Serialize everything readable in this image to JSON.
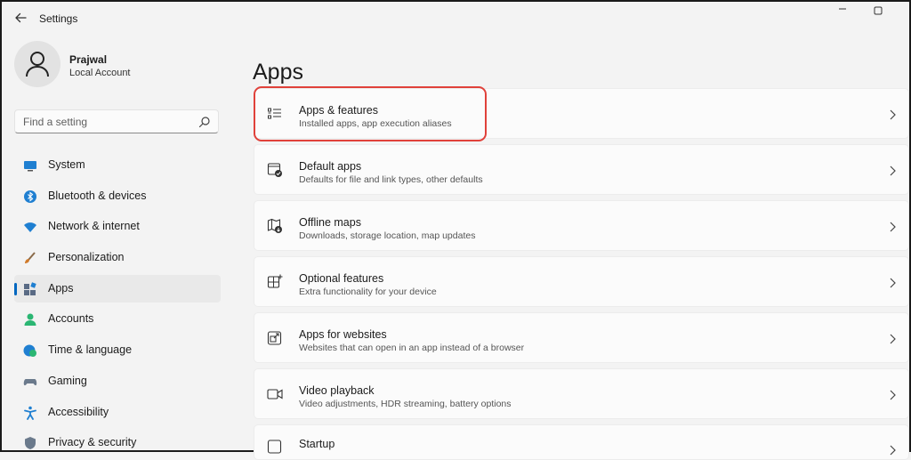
{
  "window": {
    "app_title": "Settings",
    "controls": [
      "minimize-icon",
      "maximize-icon"
    ]
  },
  "profile": {
    "name": "Prajwal",
    "account_type": "Local Account"
  },
  "search": {
    "placeholder": "Find a setting"
  },
  "sidebar": {
    "items": [
      {
        "label": "System",
        "icon": "monitor-icon",
        "color": "#1f7fd1"
      },
      {
        "label": "Bluetooth & devices",
        "icon": "bluetooth-icon",
        "color": "#1f7fd1"
      },
      {
        "label": "Network & internet",
        "icon": "wifi-icon",
        "color": "#1f7fd1"
      },
      {
        "label": "Personalization",
        "icon": "brush-icon",
        "color": "#d07a2a"
      },
      {
        "label": "Apps",
        "icon": "apps-icon",
        "color": "#5a6b85",
        "selected": true
      },
      {
        "label": "Accounts",
        "icon": "person-icon",
        "color": "#2bb673"
      },
      {
        "label": "Time & language",
        "icon": "globe-clock-icon",
        "color": "#1f7fd1"
      },
      {
        "label": "Gaming",
        "icon": "gamepad-icon",
        "color": "#6b7a8c"
      },
      {
        "label": "Accessibility",
        "icon": "accessibility-icon",
        "color": "#1f7fd1"
      },
      {
        "label": "Privacy & security",
        "icon": "shield-icon",
        "color": "#6b7a8c"
      }
    ]
  },
  "main": {
    "title": "Apps",
    "cards": [
      {
        "title": "Apps & features",
        "subtitle": "Installed apps, app execution aliases",
        "icon": "list-icon",
        "highlighted": true
      },
      {
        "title": "Default apps",
        "subtitle": "Defaults for file and link types, other defaults",
        "icon": "default-apps-icon"
      },
      {
        "title": "Offline maps",
        "subtitle": "Downloads, storage location, map updates",
        "icon": "map-download-icon"
      },
      {
        "title": "Optional features",
        "subtitle": "Extra functionality for your device",
        "icon": "add-feature-icon"
      },
      {
        "title": "Apps for websites",
        "subtitle": "Websites that can open in an app instead of a browser",
        "icon": "open-in-app-icon"
      },
      {
        "title": "Video playback",
        "subtitle": "Video adjustments, HDR streaming, battery options",
        "icon": "video-icon"
      },
      {
        "title": "Startup",
        "subtitle": "",
        "icon": "startup-icon"
      }
    ]
  },
  "colors": {
    "accent": "#0067c0",
    "highlight_border": "#e0413a"
  }
}
